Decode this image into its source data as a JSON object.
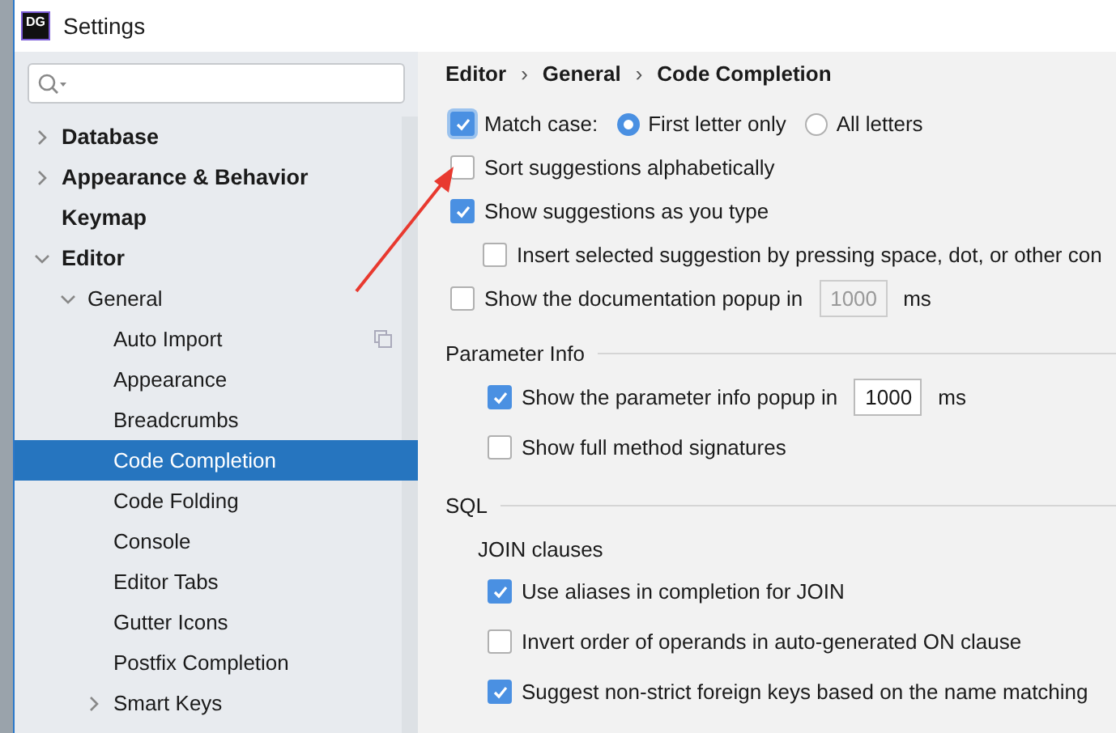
{
  "window": {
    "title": "Settings",
    "logo": "DG"
  },
  "sidebar": {
    "items": [
      {
        "label": "Database",
        "kind": "folder",
        "expanded": false,
        "selected": false
      },
      {
        "label": "Appearance & Behavior",
        "kind": "folder",
        "expanded": false,
        "selected": false
      },
      {
        "label": "Keymap",
        "kind": "leaf",
        "selected": false
      },
      {
        "label": "Editor",
        "kind": "folder",
        "expanded": true,
        "selected": false,
        "children": [
          {
            "label": "General",
            "kind": "folder",
            "expanded": true,
            "selected": false,
            "children": [
              {
                "label": "Auto Import",
                "kind": "leaf",
                "selected": false,
                "project_level": true
              },
              {
                "label": "Appearance",
                "kind": "leaf",
                "selected": false,
                "project_level": false
              },
              {
                "label": "Breadcrumbs",
                "kind": "leaf",
                "selected": false,
                "project_level": false
              },
              {
                "label": "Code Completion",
                "kind": "leaf",
                "selected": true,
                "project_level": false
              },
              {
                "label": "Code Folding",
                "kind": "leaf",
                "selected": false,
                "project_level": false
              },
              {
                "label": "Console",
                "kind": "leaf",
                "selected": false,
                "project_level": false
              },
              {
                "label": "Editor Tabs",
                "kind": "leaf",
                "selected": false,
                "project_level": false
              },
              {
                "label": "Gutter Icons",
                "kind": "leaf",
                "selected": false,
                "project_level": false
              },
              {
                "label": "Postfix Completion",
                "kind": "leaf",
                "selected": false,
                "project_level": false
              },
              {
                "label": "Smart Keys",
                "kind": "folder",
                "expanded": false,
                "selected": false,
                "project_level": false
              }
            ]
          }
        ]
      }
    ]
  },
  "breadcrumb": {
    "separator": "›",
    "items": [
      "Editor",
      "General",
      "Code Completion"
    ]
  },
  "options": [
    {
      "kind": "radios",
      "label": "Match case:",
      "checked": true,
      "radios": [
        {
          "label": "First letter only",
          "selected": true
        },
        {
          "label": "All letters",
          "selected": false
        }
      ]
    },
    {
      "kind": "checkbox",
      "label": "Sort suggestions alphabetically",
      "checked": false
    },
    {
      "kind": "checkbox",
      "label": "Show suggestions as you type",
      "checked": true,
      "children": [
        {
          "kind": "checkbox",
          "label": "Insert selected suggestion by pressing space, dot, or other con",
          "checked": false
        }
      ]
    },
    {
      "kind": "field",
      "label": "Show the documentation popup in",
      "checked": false,
      "value": "1000",
      "disabled": true,
      "unit": "ms"
    }
  ],
  "sections": [
    {
      "title": "Parameter Info",
      "items": [
        {
          "kind": "field",
          "label": "Show the parameter info popup in",
          "checked": true,
          "value": "1000",
          "disabled": false,
          "unit": "ms"
        },
        {
          "kind": "checkbox",
          "label": "Show full method signatures",
          "checked": false
        }
      ]
    },
    {
      "title": "SQL",
      "groups": [
        {
          "title": "JOIN clauses",
          "items": [
            {
              "kind": "checkbox",
              "label": "Use aliases in completion for JOIN",
              "checked": true
            },
            {
              "kind": "checkbox",
              "label": "Invert order of operands in auto-generated ON clause",
              "checked": false
            },
            {
              "kind": "checkbox",
              "label": "Suggest non-strict foreign keys based on the name matching",
              "checked": true
            }
          ]
        }
      ]
    }
  ]
}
